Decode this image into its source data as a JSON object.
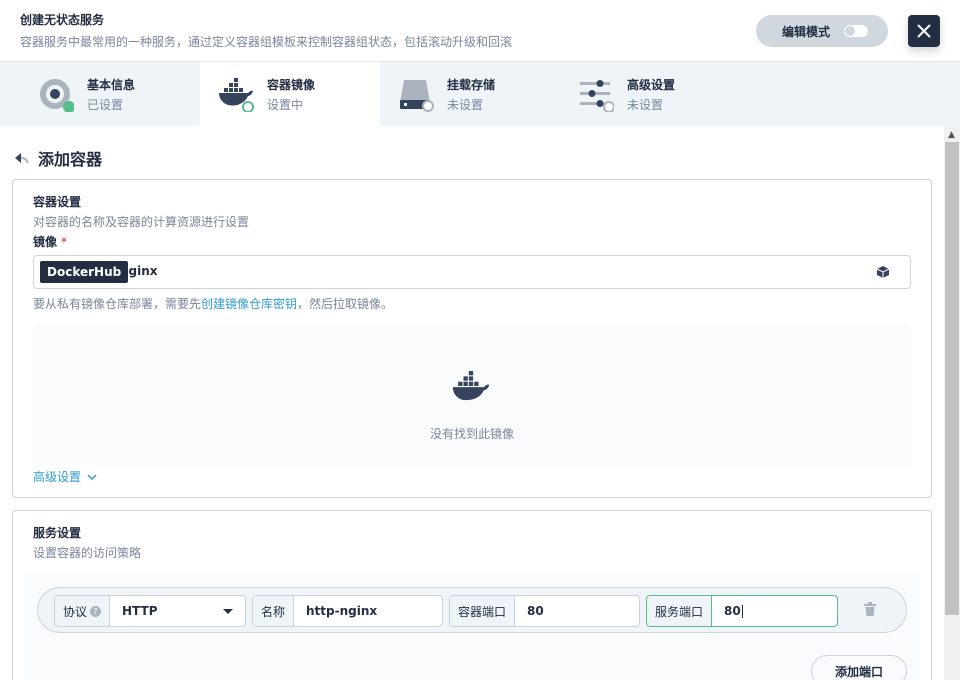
{
  "header": {
    "title": "创建无状态服务",
    "description": "容器服务中最常用的一种服务，通过定义容器组模板来控制容器组状态，包括滚动升级和回滚",
    "edit_mode_label": "编辑模式"
  },
  "tabs": [
    {
      "label": "基本信息",
      "status": "已设置",
      "icon": "info-icon"
    },
    {
      "label": "容器镜像",
      "status": "设置中",
      "icon": "docker-icon"
    },
    {
      "label": "挂载存储",
      "status": "未设置",
      "icon": "storage-icon"
    },
    {
      "label": "高级设置",
      "status": "未设置",
      "icon": "sliders-icon"
    }
  ],
  "page": {
    "back_label": "添加容器"
  },
  "container_settings": {
    "title": "容器设置",
    "description": "对容器的名称及容器的计算资源进行设置",
    "image_label": "镜像",
    "required_mark": "*",
    "registry": "DockerHub",
    "image_value": "nginx",
    "hint_prefix": "要从私有镜像仓库部署，需要先",
    "hint_link": "创建镜像仓库密钥",
    "hint_suffix": "，然后拉取镜像。",
    "empty_text": "没有找到此镜像",
    "advanced_label": "高级设置"
  },
  "service_settings": {
    "title": "服务设置",
    "description": "设置容器的访问策略",
    "port": {
      "protocol_label": "协议",
      "protocol_value": "HTTP",
      "name_label": "名称",
      "name_value": "http-nginx",
      "container_port_label": "容器端口",
      "container_port_value": "80",
      "service_port_label": "服务端口",
      "service_port_value": "80"
    },
    "add_port_label": "添加端口"
  },
  "colors": {
    "primary": "#242e42",
    "success": "#55bc8a",
    "link": "#329dce",
    "muted": "#79879c"
  }
}
